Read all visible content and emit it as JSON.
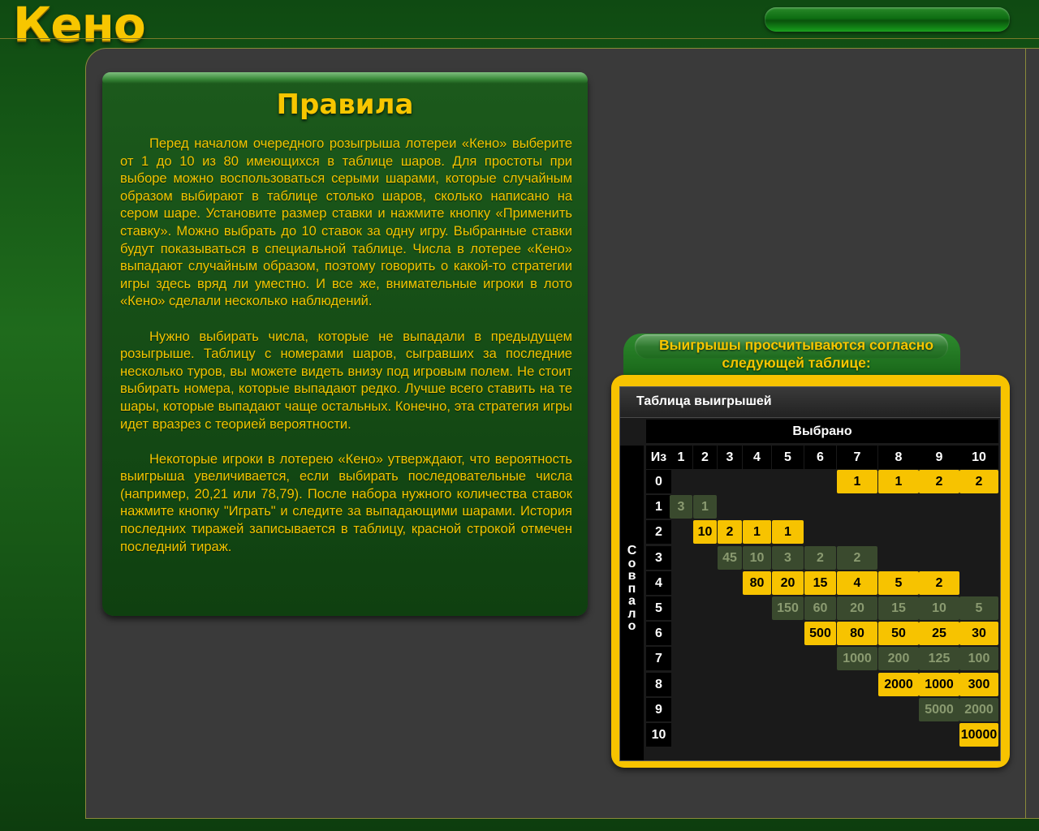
{
  "header": {
    "title": "Кено"
  },
  "rules": {
    "title": "Правила",
    "paragraphs": [
      "Перед началом очередного розыгрыша лотереи «Кено» выберите от 1 до 10 из 80 имеющихся в таблице шаров. Для простоты при выборе можно воспользоваться серыми шарами, которые случайным образом выбирают в таблице столько шаров, сколько написано на сером шаре. Установите размер ставки и нажмите кнопку «Применить ставку». Можно выбрать до 10 ставок за одну игру. Выбранные ставки будут показываться в специальной таблице. Числа в лотерее «Кено» выпадают случайным образом, поэтому говорить о какой-то стратегии игры здесь вряд ли уместно. И все же, внимательные игроки в лото «Кено» сделали несколько наблюдений.",
      "Нужно выбирать числа, которые не выпадали в предыдущем розыгрыше. Таблицу с номерами шаров, сыгравших за последние несколько туров, вы можете видеть внизу под игровым полем. Не стоит выбирать номера, которые выпадают редко. Лучше всего ставить на те шары, которые выпадают чаще остальных. Конечно, эта стратегия игры идет вразрез с теорией вероятности.",
      "Некоторые игроки в лотерею «Кено» утверждают, что вероятность выигрыша увеличивается, если выбирать последовательные числа (например, 20,21 или 78,79). После набора нужного количества ставок нажмите кнопку \"Играть\" и следите за выпадающими шарами. История последних тиражей записывается в таблицу, красной строкой отмечен последний тираж."
    ]
  },
  "payout": {
    "note": "Выигрышы просчитываются согласно следующей таблице:",
    "title": "Таблица выигрышей",
    "selected_label": "Выбрано",
    "matched_label": "Совпало",
    "corner_label": "Из",
    "columns": [
      "1",
      "2",
      "3",
      "4",
      "5",
      "6",
      "7",
      "8",
      "9",
      "10"
    ],
    "rows": [
      {
        "label": "0",
        "cells": [
          null,
          null,
          null,
          null,
          null,
          null,
          [
            "1",
            "y"
          ],
          [
            "1",
            "y"
          ],
          [
            "2",
            "y"
          ],
          [
            "2",
            "y"
          ]
        ]
      },
      {
        "label": "1",
        "cells": [
          [
            "3",
            "g"
          ],
          [
            "1",
            "g"
          ],
          null,
          null,
          null,
          null,
          null,
          null,
          null,
          null
        ]
      },
      {
        "label": "2",
        "cells": [
          null,
          [
            "10",
            "y"
          ],
          [
            "2",
            "y"
          ],
          [
            "1",
            "y"
          ],
          [
            "1",
            "y"
          ],
          null,
          null,
          null,
          null,
          null
        ]
      },
      {
        "label": "3",
        "cells": [
          null,
          null,
          [
            "45",
            "g"
          ],
          [
            "10",
            "g"
          ],
          [
            "3",
            "g"
          ],
          [
            "2",
            "g"
          ],
          [
            "2",
            "g"
          ],
          null,
          null,
          null
        ]
      },
      {
        "label": "4",
        "cells": [
          null,
          null,
          null,
          [
            "80",
            "y"
          ],
          [
            "20",
            "y"
          ],
          [
            "15",
            "y"
          ],
          [
            "4",
            "y"
          ],
          [
            "5",
            "y"
          ],
          [
            "2",
            "y"
          ],
          null
        ]
      },
      {
        "label": "5",
        "cells": [
          null,
          null,
          null,
          null,
          [
            "150",
            "g"
          ],
          [
            "60",
            "g"
          ],
          [
            "20",
            "g"
          ],
          [
            "15",
            "g"
          ],
          [
            "10",
            "g"
          ],
          [
            "5",
            "g"
          ]
        ]
      },
      {
        "label": "6",
        "cells": [
          null,
          null,
          null,
          null,
          null,
          [
            "500",
            "y"
          ],
          [
            "80",
            "y"
          ],
          [
            "50",
            "y"
          ],
          [
            "25",
            "y"
          ],
          [
            "30",
            "y"
          ]
        ]
      },
      {
        "label": "7",
        "cells": [
          null,
          null,
          null,
          null,
          null,
          null,
          [
            "1000",
            "g"
          ],
          [
            "200",
            "g"
          ],
          [
            "125",
            "g"
          ],
          [
            "100",
            "g"
          ]
        ]
      },
      {
        "label": "8",
        "cells": [
          null,
          null,
          null,
          null,
          null,
          null,
          null,
          [
            "2000",
            "y"
          ],
          [
            "1000",
            "y"
          ],
          [
            "300",
            "y"
          ]
        ]
      },
      {
        "label": "9",
        "cells": [
          null,
          null,
          null,
          null,
          null,
          null,
          null,
          null,
          [
            "5000",
            "g"
          ],
          [
            "2000",
            "g"
          ]
        ]
      },
      {
        "label": "10",
        "cells": [
          null,
          null,
          null,
          null,
          null,
          null,
          null,
          null,
          null,
          [
            "10000",
            "y"
          ]
        ]
      }
    ]
  }
}
